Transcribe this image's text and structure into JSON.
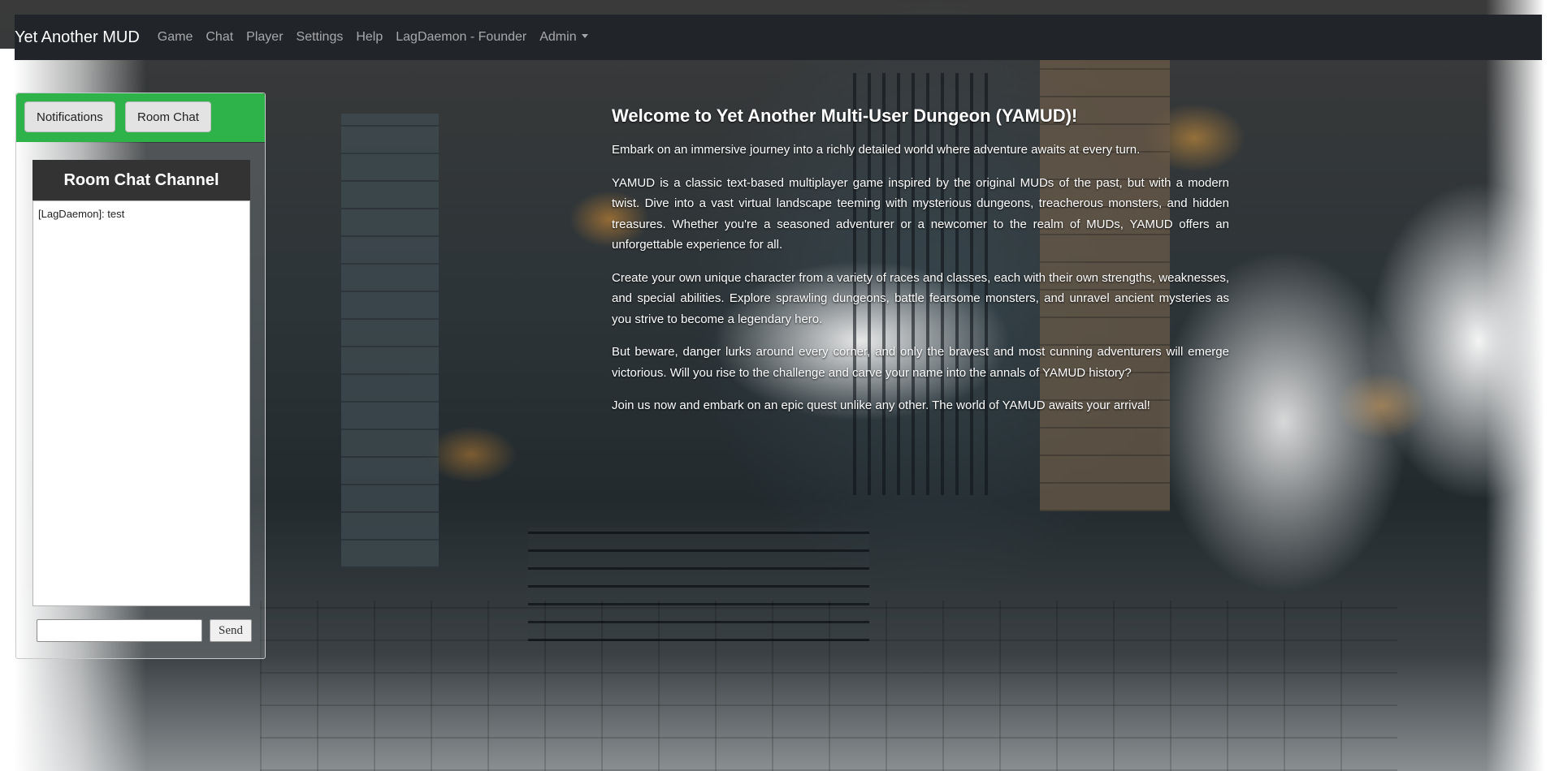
{
  "navbar": {
    "brand": "Yet Another MUD",
    "links": [
      "Game",
      "Chat",
      "Player",
      "Settings",
      "Help",
      "LagDaemon - Founder",
      "Admin"
    ]
  },
  "side_panel": {
    "tabs": [
      "Notifications",
      "Room Chat"
    ],
    "chat_title": "Room Chat Channel",
    "messages": [
      "[LagDaemon]: test"
    ],
    "input_value": "",
    "send_label": "Send"
  },
  "welcome": {
    "title": "Welcome to Yet Another Multi-User Dungeon (YAMUD)!",
    "paragraphs": [
      "Embark on an immersive journey into a richly detailed world where adventure awaits at every turn.",
      "YAMUD is a classic text-based multiplayer game inspired by the original MUDs of the past, but with a modern twist. Dive into a vast virtual landscape teeming with mysterious dungeons, treacherous monsters, and hidden treasures. Whether you're a seasoned adventurer or a newcomer to the realm of MUDs, YAMUD offers an unforgettable experience for all.",
      "Create your own unique character from a variety of races and classes, each with their own strengths, weaknesses, and special abilities. Explore sprawling dungeons, battle fearsome monsters, and unravel ancient mysteries as you strive to become a legendary hero.",
      "But beware, danger lurks around every corner, and only the bravest and most cunning adventurers will emerge victorious. Will you rise to the challenge and carve your name into the annals of YAMUD history?",
      "Join us now and embark on an epic quest unlike any other. The world of YAMUD awaits your arrival!"
    ]
  },
  "colors": {
    "navbar_bg": "#212529",
    "tab_bar_bg": "#2db34a",
    "chat_header_bg": "#333333"
  }
}
